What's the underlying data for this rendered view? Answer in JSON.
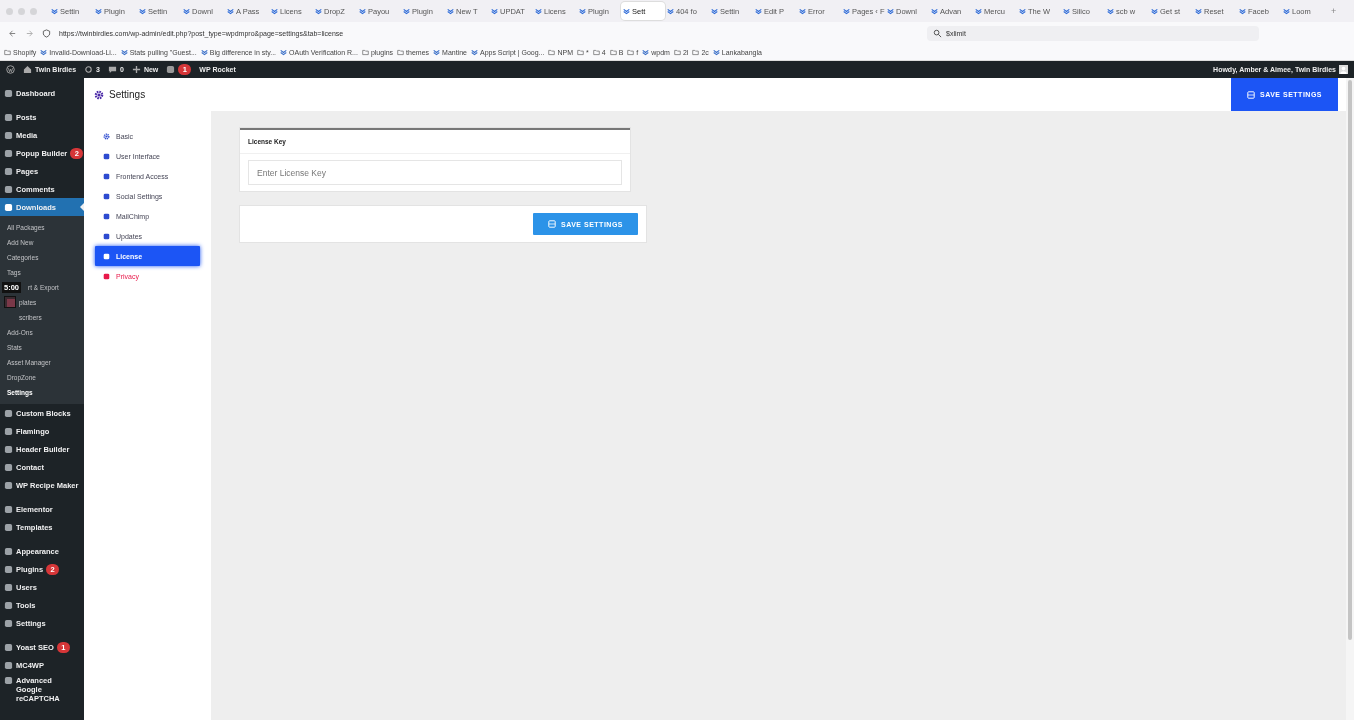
{
  "browser": {
    "tabs": [
      {
        "label": "Settin",
        "selected": false
      },
      {
        "label": "Plugin",
        "selected": false
      },
      {
        "label": "Settin",
        "selected": false
      },
      {
        "label": "Downl",
        "selected": false
      },
      {
        "label": "A Pass",
        "selected": false
      },
      {
        "label": "Licens",
        "selected": false
      },
      {
        "label": "DropZ",
        "selected": false
      },
      {
        "label": "Payou",
        "selected": false
      },
      {
        "label": "Plugin",
        "selected": false
      },
      {
        "label": "New T",
        "selected": false
      },
      {
        "label": "UPDAT",
        "selected": false
      },
      {
        "label": "Licens",
        "selected": false
      },
      {
        "label": "Plugin",
        "selected": false
      },
      {
        "label": "Sett",
        "selected": true
      },
      {
        "label": "404 fo",
        "selected": false
      },
      {
        "label": "Settin",
        "selected": false
      },
      {
        "label": "Edit P",
        "selected": false
      },
      {
        "label": "Error",
        "selected": false
      },
      {
        "label": "Pages ‹ F",
        "selected": false
      },
      {
        "label": "Downl",
        "selected": false
      },
      {
        "label": "Advan",
        "selected": false
      },
      {
        "label": "Mercu",
        "selected": false
      },
      {
        "label": "The W",
        "selected": false
      },
      {
        "label": "Silico",
        "selected": false
      },
      {
        "label": "scb w",
        "selected": false
      },
      {
        "label": "Get st",
        "selected": false
      },
      {
        "label": "Reset",
        "selected": false
      },
      {
        "label": "Faceb",
        "selected": false
      },
      {
        "label": "Loom",
        "selected": false
      }
    ],
    "new_tab": "+",
    "url": "https://twinbirdies.com/wp-admin/edit.php?post_type=wpdmpro&page=settings&tab=license",
    "search": "$xlimit",
    "bookmarks": [
      {
        "kind": "folder",
        "label": "Shopify"
      },
      {
        "kind": "link",
        "label": "Invalid-Download-Li..."
      },
      {
        "kind": "link",
        "label": "Stats pulling \"Guest..."
      },
      {
        "kind": "link",
        "label": "Big difference in sty..."
      },
      {
        "kind": "link",
        "label": "OAuth Verification R..."
      },
      {
        "kind": "folder",
        "label": "plugins"
      },
      {
        "kind": "folder",
        "label": "themes"
      },
      {
        "kind": "link",
        "label": "Mantine"
      },
      {
        "kind": "link",
        "label": "Apps Script | Goog..."
      },
      {
        "kind": "folder",
        "label": "NPM"
      },
      {
        "kind": "folder",
        "label": "*"
      },
      {
        "kind": "folder",
        "label": "4"
      },
      {
        "kind": "folder",
        "label": "B"
      },
      {
        "kind": "folder",
        "label": "f"
      },
      {
        "kind": "link",
        "label": "wpdm"
      },
      {
        "kind": "folder",
        "label": "2l"
      },
      {
        "kind": "folder",
        "label": "2c"
      },
      {
        "kind": "link",
        "label": "Lankabangla"
      }
    ]
  },
  "admin_bar": {
    "site": "Twin Birdies",
    "updates": "3",
    "comments": "0",
    "new": "New",
    "notifications": "1",
    "rocket": "WP Rocket",
    "greeting": "Howdy, Amber & Aimee, Twin Birdies"
  },
  "sidebar": {
    "groups": [
      {
        "items": [
          {
            "label": "Dashboard",
            "selected": false
          }
        ]
      },
      {
        "items": [
          {
            "label": "Posts",
            "selected": false
          },
          {
            "label": "Media",
            "selected": false
          },
          {
            "label": "Popup Builder",
            "badge": "2",
            "selected": false
          },
          {
            "label": "Pages",
            "selected": false
          },
          {
            "label": "Comments",
            "selected": false
          },
          {
            "label": "Downloads",
            "selected": true,
            "children": [
              {
                "label": "All Packages",
                "selected": false,
                "covered": false
              },
              {
                "label": "Add New",
                "selected": false,
                "covered": false
              },
              {
                "label": "Categories",
                "selected": false,
                "covered": false
              },
              {
                "label": "Tags",
                "selected": false,
                "covered": false
              },
              {
                "label": "rt & Export",
                "selected": false,
                "covered": true
              },
              {
                "label": "plates",
                "selected": false,
                "covered": true
              },
              {
                "label": "scribers",
                "selected": false,
                "covered": true
              },
              {
                "label": "Add-Ons",
                "selected": false,
                "covered": false
              },
              {
                "label": "Stats",
                "selected": false,
                "covered": false
              },
              {
                "label": "Asset Manager",
                "selected": false,
                "covered": false
              },
              {
                "label": "DropZone",
                "selected": false,
                "covered": false
              },
              {
                "label": "Settings",
                "selected": true,
                "covered": false
              }
            ]
          },
          {
            "label": "Custom Blocks",
            "selected": false
          },
          {
            "label": "Flamingo",
            "selected": false
          },
          {
            "label": "Header Builder",
            "selected": false
          },
          {
            "label": "Contact",
            "selected": false
          },
          {
            "label": "WP Recipe Maker",
            "selected": false
          }
        ]
      },
      {
        "items": [
          {
            "label": "Elementor",
            "selected": false
          },
          {
            "label": "Templates",
            "selected": false
          }
        ]
      },
      {
        "items": [
          {
            "label": "Appearance",
            "selected": false
          },
          {
            "label": "Plugins",
            "badge": "2",
            "selected": false
          },
          {
            "label": "Users",
            "selected": false
          },
          {
            "label": "Tools",
            "selected": false
          },
          {
            "label": "Settings",
            "selected": false
          }
        ]
      },
      {
        "items": [
          {
            "label": "Yoast SEO",
            "badge": "1",
            "selected": false
          },
          {
            "label": "MC4WP",
            "selected": false
          },
          {
            "label": "Advanced Google reCAPTCHA",
            "selected": false
          }
        ]
      }
    ]
  },
  "overlay": {
    "timer": "5:00"
  },
  "header": {
    "title": "Settings",
    "button": "SAVE SETTINGS"
  },
  "settings_menu": [
    {
      "label": "Basic",
      "kind": "normal",
      "selected": false
    },
    {
      "label": "User Interface",
      "kind": "normal",
      "selected": false
    },
    {
      "label": "Frontend Access",
      "kind": "normal",
      "selected": false
    },
    {
      "label": "Social Settings",
      "kind": "normal",
      "selected": false
    },
    {
      "label": "MailChimp",
      "kind": "normal",
      "selected": false
    },
    {
      "label": "Updates",
      "kind": "normal",
      "selected": false
    },
    {
      "label": "License",
      "kind": "normal",
      "selected": true
    },
    {
      "label": "Privacy",
      "kind": "danger",
      "selected": false
    }
  ],
  "license_card": {
    "title": "License Key",
    "placeholder": "Enter License Key"
  },
  "save_card": {
    "button": "SAVE SETTINGS"
  }
}
